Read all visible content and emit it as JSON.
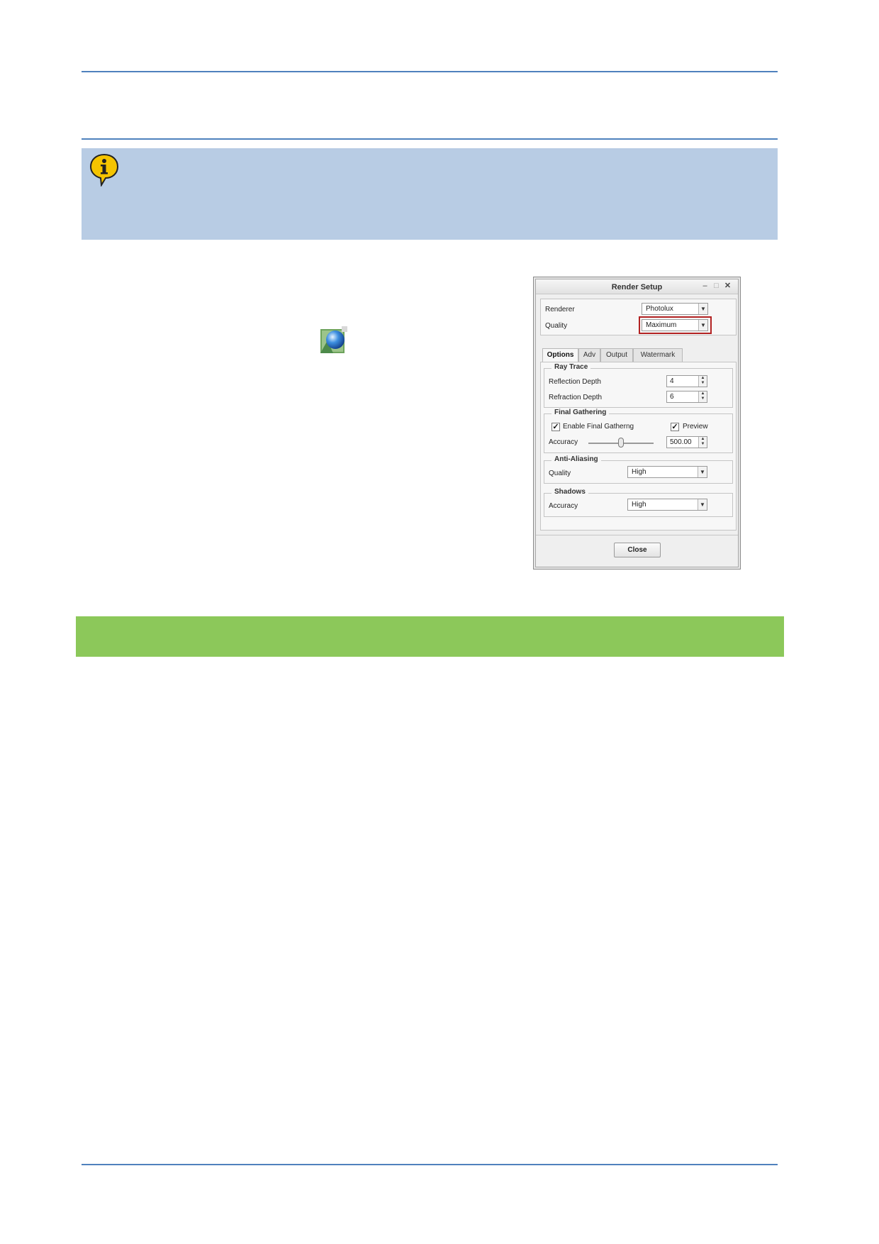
{
  "dialog": {
    "title": "Render Setup",
    "minimize_glyph": "–",
    "maximize_glyph": "□",
    "close_glyph": "✕",
    "renderer_label": "Renderer",
    "renderer_value": "Photolux",
    "quality_label": "Quality",
    "quality_value": "Maximum",
    "dropdown_glyph": "▼",
    "tabs": [
      "Options",
      "Adv",
      "Output",
      "Watermark"
    ],
    "ray_trace": {
      "title": "Ray Trace",
      "reflection_label": "Reflection Depth",
      "reflection_value": "4",
      "refraction_label": "Refraction Depth",
      "refraction_value": "6"
    },
    "final_gathering": {
      "title": "Final Gathering",
      "enable_label": "Enable Final Gatherng",
      "enable_checked": true,
      "preview_label": "Preview",
      "preview_checked": true,
      "accuracy_label": "Accuracy",
      "accuracy_value": "500.00",
      "slider_level": 0.5
    },
    "anti_aliasing": {
      "title": "Anti-Aliasing",
      "quality_label": "Quality",
      "quality_value": "High"
    },
    "shadows": {
      "title": "Shadows",
      "accuracy_label": "Accuracy",
      "accuracy_value": "High"
    },
    "close_button": "Close",
    "check_glyph": "✓",
    "spin_up_glyph": "▲",
    "spin_down_glyph": "▼"
  },
  "colors": {
    "rule": "#4f81bd",
    "info_box": "#b8cce4",
    "green_bar": "#8cc85a",
    "highlight": "#b22222"
  },
  "icons": {
    "info": "info-speech-bubble-icon",
    "app": "render-sphere-icon"
  }
}
